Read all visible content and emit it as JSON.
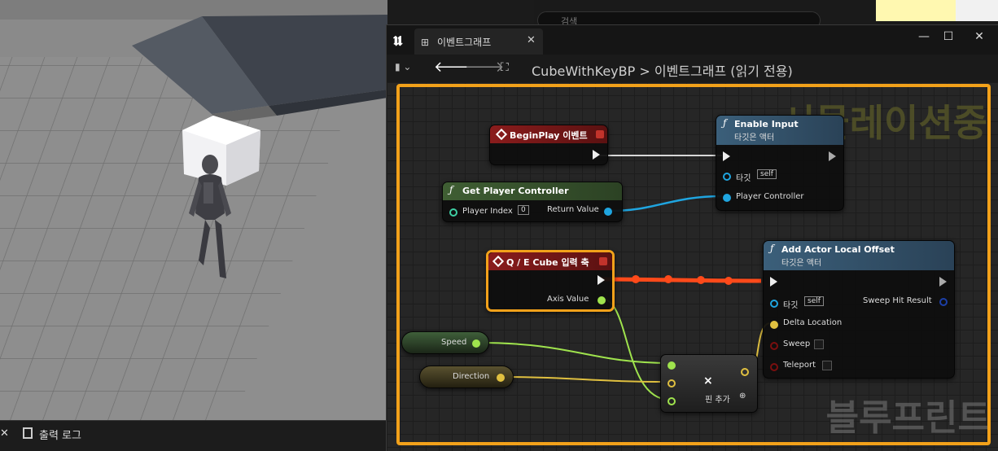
{
  "viewport": {
    "bottom_tab": {
      "close_glyph": "✕",
      "log_label": "출력 로그"
    }
  },
  "background": {
    "search_placeholder": "검색"
  },
  "window": {
    "tab_label": "이벤트그래프",
    "close_glyph": "✕",
    "minimize_glyph": "—",
    "maximize_glyph": "☐",
    "window_close_glyph": "✕"
  },
  "toolbar": {
    "back_glyph": "🡐",
    "forward_glyph": "🡒",
    "breadcrumb": "CubeWithKeyBP > 이벤트그래프   (읽기 전용)"
  },
  "overlay": {
    "simulating": "시뮬레이션중",
    "watermark": "블루프린트"
  },
  "nodes": {
    "begin_play": {
      "title": "BeginPlay 이벤트"
    },
    "enable_input": {
      "title": "Enable Input",
      "subtitle": "타깃은 액터",
      "target_label": "타깃",
      "target_value": "self",
      "player_controller": "Player Controller"
    },
    "get_player_controller": {
      "title": "Get Player Controller",
      "player_index_label": "Player Index",
      "player_index_value": "0",
      "return_value": "Return Value"
    },
    "qe_axis": {
      "title": "Q / E Cube 입력 축",
      "axis_value": "Axis Value"
    },
    "add_offset": {
      "title": "Add Actor Local Offset",
      "subtitle": "타깃은 액터",
      "target_label": "타깃",
      "target_value": "self",
      "sweep_hit_result": "Sweep Hit Result",
      "delta_location": "Delta Location",
      "sweep": "Sweep",
      "teleport": "Teleport"
    },
    "speed": {
      "label": "Speed"
    },
    "direction": {
      "label": "Direction"
    },
    "multiply": {
      "symbol": "×",
      "add_pin": "핀 추가"
    }
  },
  "colors": {
    "accent_frame": "#f2a11a",
    "event_header": "#8a1c1c",
    "function_header": "#3b5f7a",
    "pure_header": "#3f5e33",
    "exec_wire_active": "#ff4a1a",
    "float_pin": "#9fe34d",
    "vector_pin": "#e0c040",
    "object_pin": "#1fa5e0",
    "bool_pin": "#7a0f0f"
  }
}
